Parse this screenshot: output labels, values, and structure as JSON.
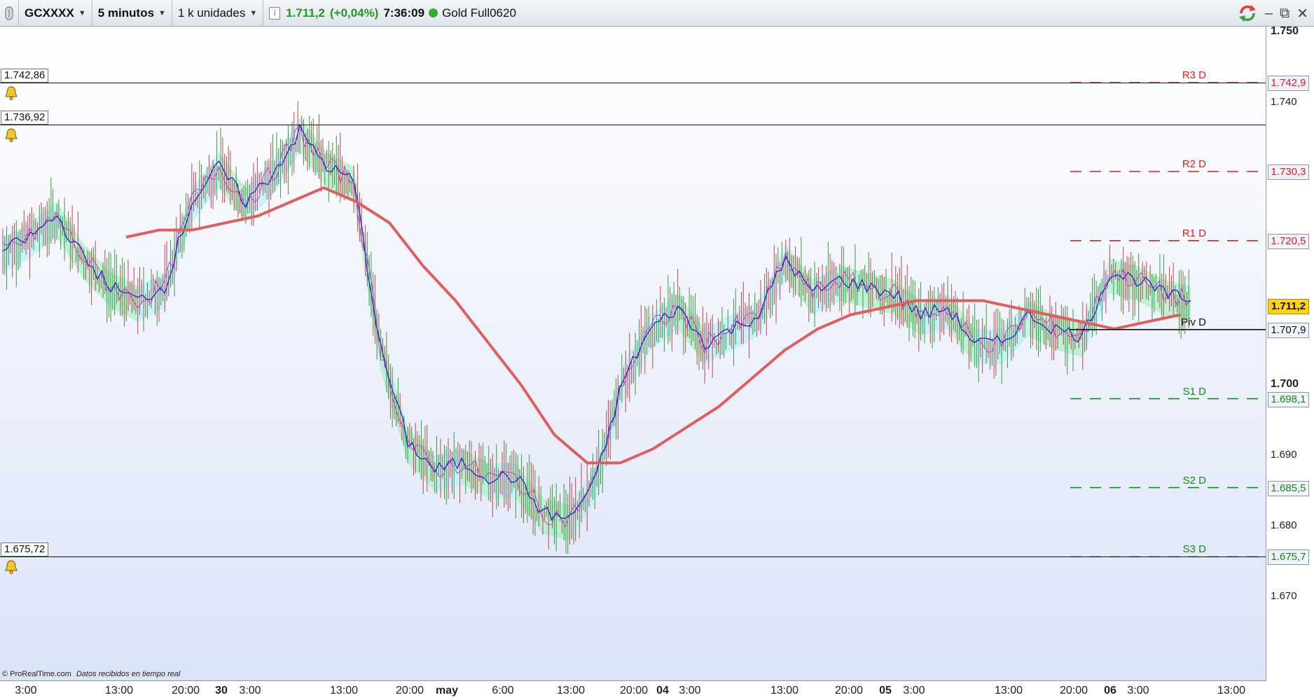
{
  "toolbar": {
    "symbol": "GCXXXX",
    "timeframe": "5 minutos",
    "units": "1 k unidades",
    "info_icon": "info-icon",
    "last_price": "1.711,2",
    "change": "(+0,04%)",
    "time": "7:36:09",
    "contract": "Gold Full0620",
    "status_color": "#2eb02e"
  },
  "window_controls": {
    "refresh_icon": "refresh-icon",
    "minimize": "–",
    "restore": "⧉",
    "close": "✕"
  },
  "alerts": [
    {
      "price_label": "1.742,86",
      "icon": "bell-icon"
    },
    {
      "price_label": "1.736,92",
      "icon": "bell-icon"
    },
    {
      "price_label": "1.675,72",
      "icon": "bell-icon"
    }
  ],
  "pivots": [
    {
      "label": "R3 D",
      "value": "1.742,9",
      "color": "#e01b1b",
      "price": 1742.9,
      "style": "dashed"
    },
    {
      "label": "R2 D",
      "value": "1.730,3",
      "color": "#e01b1b",
      "price": 1730.3,
      "style": "dashed"
    },
    {
      "label": "R1 D",
      "value": "1.720,5",
      "color": "#e01b1b",
      "price": 1720.5,
      "style": "dashed"
    },
    {
      "label": "Piv D",
      "value": "1.707,9",
      "color": "#111111",
      "price": 1707.9,
      "style": "solid"
    },
    {
      "label": "S1 D",
      "value": "1.698,1",
      "color": "#138a13",
      "price": 1698.1,
      "style": "dashed"
    },
    {
      "label": "S2 D",
      "value": "1.685,5",
      "color": "#138a13",
      "price": 1685.5,
      "style": "dashed"
    },
    {
      "label": "S3 D",
      "value": "1.675,7",
      "color": "#138a13",
      "price": 1675.7,
      "style": "dashed"
    }
  ],
  "current_price_tag": {
    "value": "1.711,2",
    "color": "#ffd21a",
    "price": 1711.2
  },
  "y_axis": [
    {
      "label": "1.750",
      "price": 1750,
      "bold": true
    },
    {
      "label": "1.740",
      "price": 1740,
      "bold": false
    },
    {
      "label": "1.700",
      "price": 1700,
      "bold": true
    },
    {
      "label": "1.690",
      "price": 1690,
      "bold": false
    },
    {
      "label": "1.680",
      "price": 1680,
      "bold": false
    },
    {
      "label": "1.670",
      "price": 1670,
      "bold": false
    }
  ],
  "x_axis": [
    {
      "label": "3:00",
      "bold": false
    },
    {
      "label": "13:00",
      "bold": false
    },
    {
      "label": "20:00",
      "bold": false
    },
    {
      "label": "30",
      "bold": true
    },
    {
      "label": "3:00",
      "bold": false
    },
    {
      "label": "13:00",
      "bold": false
    },
    {
      "label": "20:00",
      "bold": false
    },
    {
      "label": "may",
      "bold": true
    },
    {
      "label": "6:00",
      "bold": false
    },
    {
      "label": "13:00",
      "bold": false
    },
    {
      "label": "20:00",
      "bold": false
    },
    {
      "label": "04",
      "bold": true
    },
    {
      "label": "3:00",
      "bold": false
    },
    {
      "label": "13:00",
      "bold": false
    },
    {
      "label": "20:00",
      "bold": false
    },
    {
      "label": "05",
      "bold": true
    },
    {
      "label": "3:00",
      "bold": false
    },
    {
      "label": "13:00",
      "bold": false
    },
    {
      "label": "20:00",
      "bold": false
    },
    {
      "label": "06",
      "bold": true
    },
    {
      "label": "3:00",
      "bold": false
    },
    {
      "label": "13:00",
      "bold": false
    }
  ],
  "footer": {
    "brand": "© ProRealTime.com",
    "status": "Datos recibidos en tiempo real"
  },
  "chart_data": {
    "type": "line",
    "series": [
      {
        "values": [
          1719,
          1721,
          1724,
          1718,
          1714,
          1712,
          1714,
          1726,
          1731,
          1726,
          1730,
          1736,
          1731,
          1729,
          1705,
          1692,
          1688,
          1689,
          1687,
          1687,
          1682,
          1681,
          1687,
          1701,
          1708,
          1711,
          1706,
          1708,
          1710,
          1718,
          1713,
          1715,
          1714,
          1713,
          1710,
          1711,
          1706,
          1706,
          1710,
          1708,
          1707,
          1716,
          1715,
          1713,
          1712
        ]
      },
      {
        "values": [
          1721,
          1722,
          1722,
          1723,
          1724,
          1726,
          1728,
          1726,
          1723,
          1717,
          1712,
          1706,
          1700,
          1693,
          1689,
          1689,
          1691,
          1694,
          1697,
          1701,
          1705,
          1708,
          1710,
          1711,
          1712,
          1712,
          1712,
          1711,
          1710,
          1709,
          1708,
          1709,
          1710
        ]
      }
    ],
    "ylim": [
      1665,
      1755
    ],
    "grid": false
  }
}
